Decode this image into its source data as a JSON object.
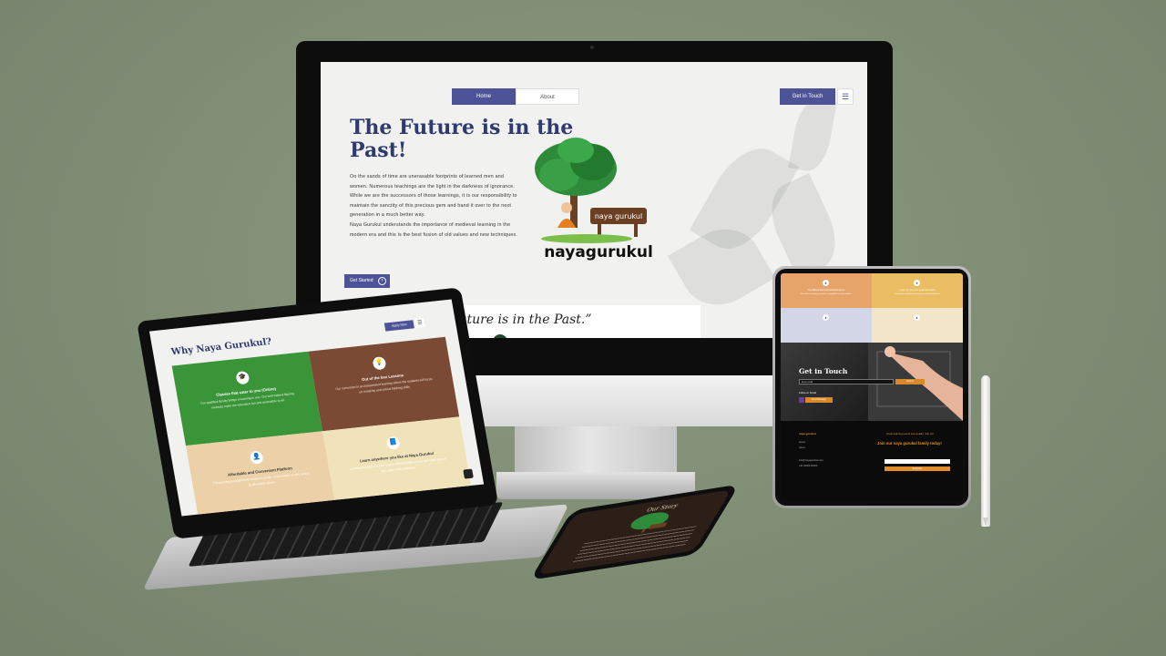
{
  "desktop": {
    "nav": {
      "home": "Home",
      "about": "About",
      "contact": "Get in Touch",
      "menu_icon": "hamburger-icon"
    },
    "hero": {
      "title": "The Future is in the Past!",
      "paragraphs": [
        "On the sands of time are unerasable footprints of learned men and women. Numerous teachings are the light in the darkness of ignorance.",
        "While we are the successors of those learnings, it is our responsibility to maintain the sanctity of this precious gem and hand it over to the next generation in a much better way.",
        "Naya Gurukul understands the importance of medieval learning in the modern era and this is the best fusion of old values and new techniques."
      ],
      "button": "Get Started",
      "button_icon": "arrow-right-circle-icon"
    },
    "logo": {
      "sign_text": "naya gurukul",
      "wordmark": "nayagurukul"
    },
    "quote": "e Future is in the Past.”"
  },
  "laptop": {
    "section_title": "Why Naya Gurukul?",
    "button": "Apply Now",
    "tiles": [
      {
        "color": "#3a9438",
        "title": "Classes that cater to you (Online)",
        "text": "Our qualified faculty brings a learning to you. Our well-trained flipping methods make the education fun and accessible to all.",
        "icon": "graduation-icon"
      },
      {
        "color": "#7b4a34",
        "title": "Out of the box Lessons",
        "text": "Our curriculum is an independent learning where the students will focus on creativity and critical thinking skills.",
        "icon": "lightbulb-icon"
      },
      {
        "color": "#ecd0a8",
        "title": "Affordable and Convenient Platform",
        "text": "The learning management system is simple, and it works on any device at affordable prices.",
        "icon": "user-icon"
      },
      {
        "color": "#f1e3b9",
        "title": "Learn anywhere you like at Naya Gurukul",
        "text": "Learning at Naya Gurukul comes with flexibility so you can learn at your own pace from anywhere.",
        "icon": "book-icon"
      }
    ]
  },
  "tablet": {
    "tiles": [
      {
        "color": "#e6a36a",
        "title": "Fun-Based Educational Experience",
        "text": "We believe learning should be enjoyable for every student."
      },
      {
        "color": "#ebbd63",
        "title": "Learn at your own pace and place",
        "text": "Study from anywhere at any time with flexible plans."
      },
      {
        "color": "#d2d6e6",
        "title": "",
        "text": ""
      },
      {
        "color": "#f3e5c8",
        "title": "",
        "text": ""
      }
    ],
    "contact": {
      "title": "Get in Touch",
      "input_placeholder": "Enter email",
      "submit": "Submit",
      "link": "Follow on Social",
      "button": "Send Message"
    },
    "footer": {
      "brand": "naya gurukul",
      "links": [
        "Home",
        "About"
      ],
      "email": "info@nayagurukul.com",
      "phone": "+91 00000 00000",
      "tagline": "Great learning needs less quality. Join Us!",
      "join": "Join our naya gurukul family today!",
      "subscribe": "Subscribe"
    }
  },
  "phone": {
    "title": "Our Story"
  }
}
